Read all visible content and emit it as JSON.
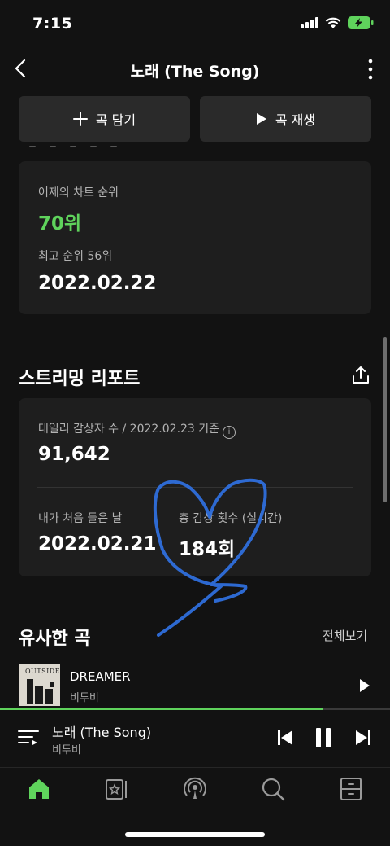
{
  "status_bar": {
    "time": "7:15"
  },
  "header": {
    "title": "노래 (The Song)"
  },
  "actions": {
    "add_label": "곡 담기",
    "play_label": "곡 재생"
  },
  "chart_card": {
    "yesterday_label": "어제의 차트 순위",
    "yesterday_rank": "70위",
    "best_label": "최고 순위 56위",
    "best_date": "2022.02.22"
  },
  "report": {
    "title": "스트리밍 리포트",
    "daily_label": "데일리 감상자 수 / 2022.02.23 기준",
    "daily_value": "91,642",
    "first_label": "내가 처음 들은 날",
    "first_value": "2022.02.21",
    "total_label": "총 감상 횟수 (실시간)",
    "total_value": "184회"
  },
  "similar": {
    "title": "유사한 곡",
    "see_all": "전체보기",
    "songs": [
      {
        "title": "DREAMER",
        "artist": "비투비",
        "album_text": "OUTSIDE"
      }
    ]
  },
  "player": {
    "title": "노래 (The Song)",
    "artist": "비투비",
    "progress": 0.83
  },
  "colors": {
    "accent": "#5fd35c",
    "background": "#121212",
    "card": "#1e1e1e",
    "scribble": "#2f6fdc"
  },
  "icons": [
    "back-icon",
    "more-icon",
    "plus-icon",
    "play-icon",
    "share-icon",
    "info-icon",
    "queue-icon",
    "previous-icon",
    "pause-icon",
    "next-icon",
    "home-icon",
    "library-icon",
    "podcast-icon",
    "search-icon",
    "storage-icon"
  ]
}
